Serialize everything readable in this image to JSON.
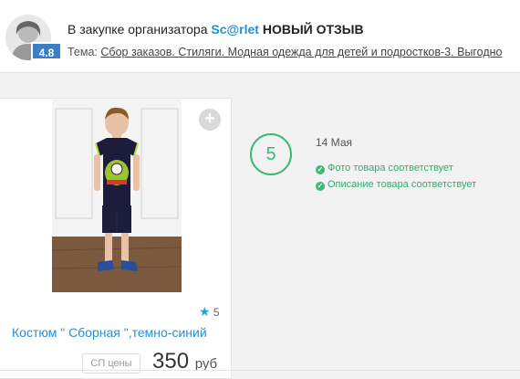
{
  "header": {
    "prefix": "В закупке организатора",
    "organizer": "Sc@rlet",
    "new_review": "НОВЫЙ ОТЗЫВ",
    "topic_label": "Тема:",
    "topic_link": "Сбор заказов. Стиляги. Модная одежда для детей и подростков-3. Выгодно",
    "rating": "4.8"
  },
  "product": {
    "name": "Костюм \" Сборная \",темно-синий",
    "rating": "5",
    "sp_price_label": "СП цены",
    "price": "350",
    "currency": "руб",
    "add_icon": "plus-icon",
    "star_icon": "star-icon"
  },
  "review": {
    "score": "5",
    "date": "14 Мая",
    "checks": [
      "Фото товара соответствует",
      "Описание товара соответствует"
    ],
    "check_color": "#3cb878"
  },
  "colors": {
    "link": "#2a8fd0",
    "badge": "#3a7fc1",
    "accent_green": "#3cb878"
  }
}
